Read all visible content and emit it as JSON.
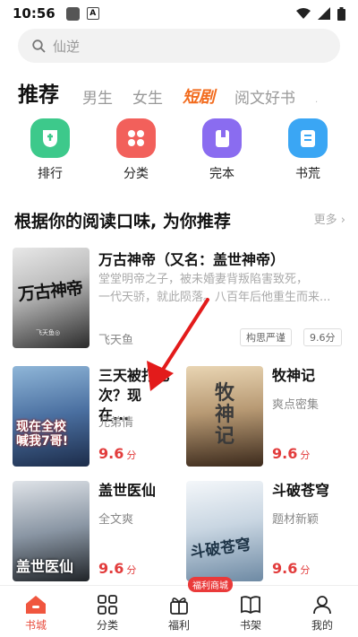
{
  "status": {
    "time": "10:56"
  },
  "search": {
    "placeholder": "仙逆"
  },
  "tabs": [
    {
      "label": "推荐"
    },
    {
      "label": "男生"
    },
    {
      "label": "女生"
    },
    {
      "label": "短剧"
    },
    {
      "label": "阅文好书"
    }
  ],
  "categories": [
    {
      "label": "排行",
      "icon": "ranking-icon",
      "color": "#3dc98b"
    },
    {
      "label": "分类",
      "icon": "category-icon",
      "color": "#f2605b"
    },
    {
      "label": "完本",
      "icon": "finished-book-icon",
      "color": "#8a6cf0"
    },
    {
      "label": "书荒",
      "icon": "book-shortage-icon",
      "color": "#3aa6f4"
    }
  ],
  "section": {
    "title": "根据你的阅读口味, 为你推荐",
    "more": "更多"
  },
  "featured": {
    "title": "万古神帝（又名：盖世神帝）",
    "desc_line1": "堂堂明帝之子，被未婚妻背叛陷害致死，",
    "desc_line2": "一代天骄，就此陨落。八百年后他重生而来...",
    "author": "飞天鱼",
    "tags": [
      "构思严谨",
      "9.6分"
    ],
    "cover_text": "万古神帝",
    "cover_author": "飞天鱼◎"
  },
  "books": [
    {
      "title_line1": "三天被打七",
      "title_line2": "次？现在...",
      "author": "兄弟情",
      "score": "9.6",
      "unit": "分",
      "cover_text": "现在全校\n喊我7哥!"
    },
    {
      "title_line1": "牧神记",
      "title_line2": "",
      "author": "爽点密集",
      "score": "9.6",
      "unit": "分",
      "cover_text": "牧神记"
    },
    {
      "title_line1": "盖世医仙",
      "title_line2": "",
      "author": "全文爽",
      "score": "9.6",
      "unit": "分",
      "cover_text": "盖世医仙"
    },
    {
      "title_line1": "斗破苍穹",
      "title_line2": "",
      "author": "题材新颖",
      "score": "9.6",
      "unit": "分",
      "cover_text": "斗破苍穹"
    }
  ],
  "nav": [
    {
      "label": "书城"
    },
    {
      "label": "分类"
    },
    {
      "label": "福利",
      "badge": "福利商城"
    },
    {
      "label": "书架"
    },
    {
      "label": "我的"
    }
  ]
}
